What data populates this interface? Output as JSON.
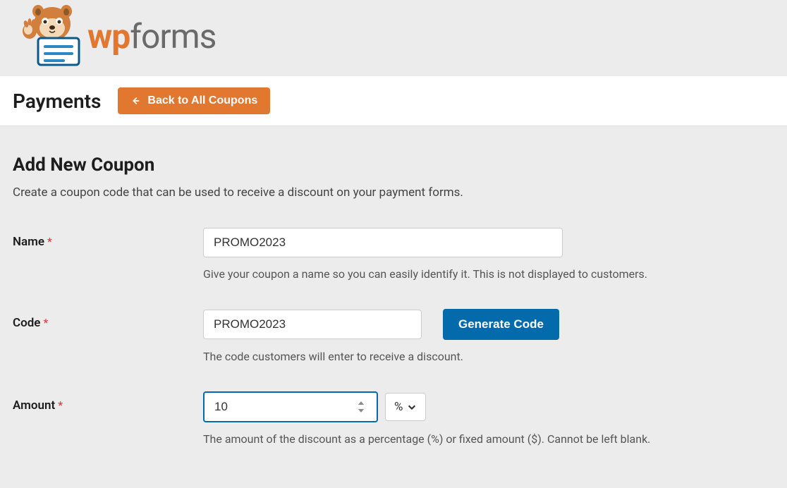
{
  "logo": {
    "prefix": "wp",
    "suffix": "forms"
  },
  "header": {
    "title": "Payments",
    "back_button": "Back to All Coupons"
  },
  "section": {
    "title": "Add New Coupon",
    "description": "Create a coupon code that can be used to receive a discount on your payment forms."
  },
  "fields": {
    "name": {
      "label": "Name",
      "value": "PROMO2023",
      "help": "Give your coupon a name so you can easily identify it. This is not displayed to customers."
    },
    "code": {
      "label": "Code",
      "value": "PROMO2023",
      "generate_button": "Generate Code",
      "help": "The code customers will enter to receive a discount."
    },
    "amount": {
      "label": "Amount",
      "value": "10",
      "unit": "%",
      "help": "The amount of the discount as a percentage (%) or fixed amount ($). Cannot be left blank."
    }
  },
  "required_marker": "*"
}
